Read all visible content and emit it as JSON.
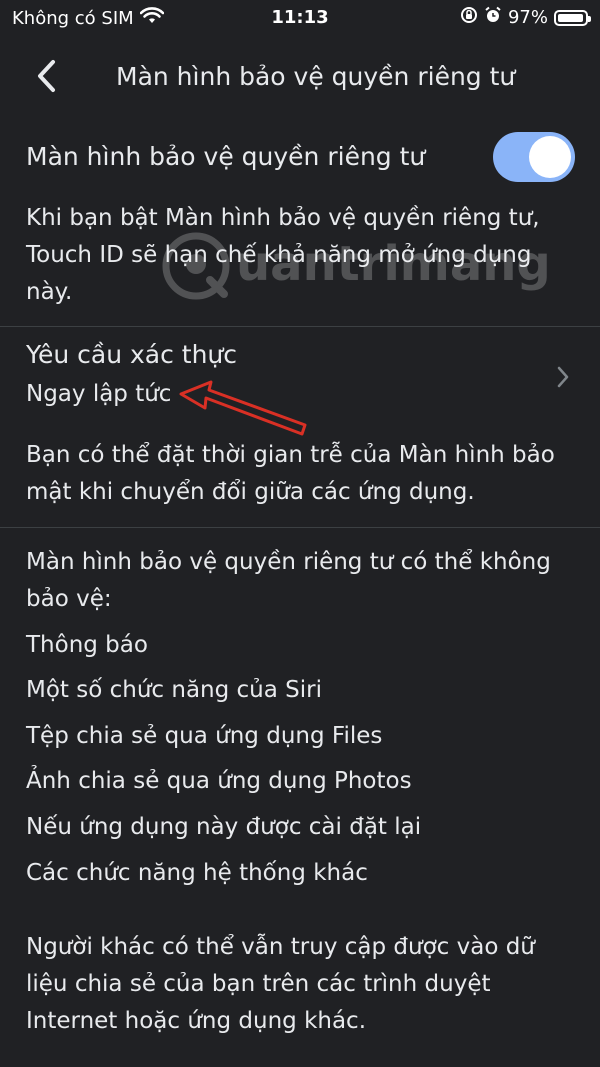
{
  "status_bar": {
    "carrier": "Không có SIM",
    "time": "11:13",
    "battery_percent": "97%",
    "battery_level": 0.97
  },
  "header": {
    "title": "Màn hình bảo vệ quyền riêng tư",
    "back_icon": "chevron-left-icon"
  },
  "privacy_toggle": {
    "label": "Màn hình bảo vệ quyền riêng tư",
    "enabled": true,
    "accent_color": "#8ab4f8"
  },
  "toggle_description": [
    "Khi bạn bật Màn hình bảo vệ quyền riêng tư,",
    "Touch ID sẽ hạn chế khả năng mở ứng dụng",
    "này."
  ],
  "auth_setting": {
    "title": "Yêu cầu xác thực",
    "value": "Ngay lập tức",
    "chevron_icon": "chevron-right-icon"
  },
  "auth_description": [
    "Bạn có thể đặt thời gian trễ của Màn hình bảo",
    "mật khi chuyển đổi giữa các ứng dụng."
  ],
  "limitations": {
    "intro": [
      "Màn hình bảo vệ quyền riêng tư có thể không",
      "bảo vệ:"
    ],
    "items": [
      "Thông báo",
      "Một số chức năng của Siri",
      "Tệp chia sẻ qua ứng dụng Files",
      "Ảnh chia sẻ qua ứng dụng Photos",
      "Nếu ứng dụng này được cài đặt lại",
      "Các chức năng hệ thống khác"
    ]
  },
  "footer_note": [
    "Người khác có thể vẫn truy cập được vào dữ",
    "liệu chia sẻ của bạn trên các trình duyệt",
    "Internet hoặc ứng dụng khác."
  ],
  "annotation": {
    "arrow_color": "#d93025",
    "icon": "red-arrow-icon"
  },
  "watermark": {
    "text": "uantrimang",
    "icon": "quantrimang-logo-icon"
  },
  "colors": {
    "background": "#202124",
    "text": "#e8eaed",
    "divider": "#3c4043"
  }
}
